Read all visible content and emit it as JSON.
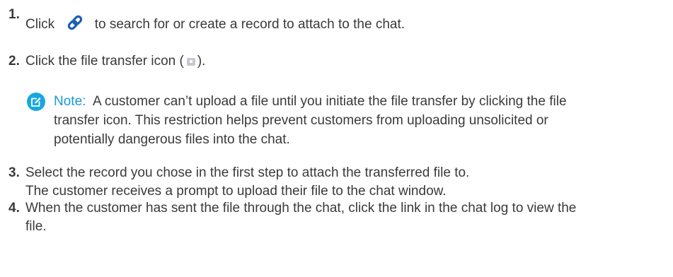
{
  "steps": [
    {
      "number": "1.",
      "before_icon": "Click",
      "icon": "link-attach-icon",
      "after_icon": "to search for or create a record to attach to the chat."
    },
    {
      "number": "2.",
      "before_icon": "Click the file transfer icon (",
      "icon": "file-transfer-icon",
      "after_icon": ")."
    },
    {
      "number": "3.",
      "line1": "Select the record you chose in the first step to attach the transferred file to.",
      "line2": "The customer receives a prompt to upload their file to the chat window."
    },
    {
      "number": "4.",
      "line1": "When the customer has sent the file through the chat, click the link in the chat log to view the",
      "line2": "file."
    }
  ],
  "note": {
    "label": "Note:",
    "line1": "A customer can’t upload a file until you initiate the file transfer by clicking the file",
    "line2": "transfer icon. This restriction helps prevent customers from uploading unsolicited or",
    "line3": "potentially dangerous files into the chat.",
    "icon": "note-edit-icon"
  },
  "colors": {
    "text": "#3a3a3a",
    "accent": "#18a8e0",
    "note_label": "#1a9ad6"
  }
}
